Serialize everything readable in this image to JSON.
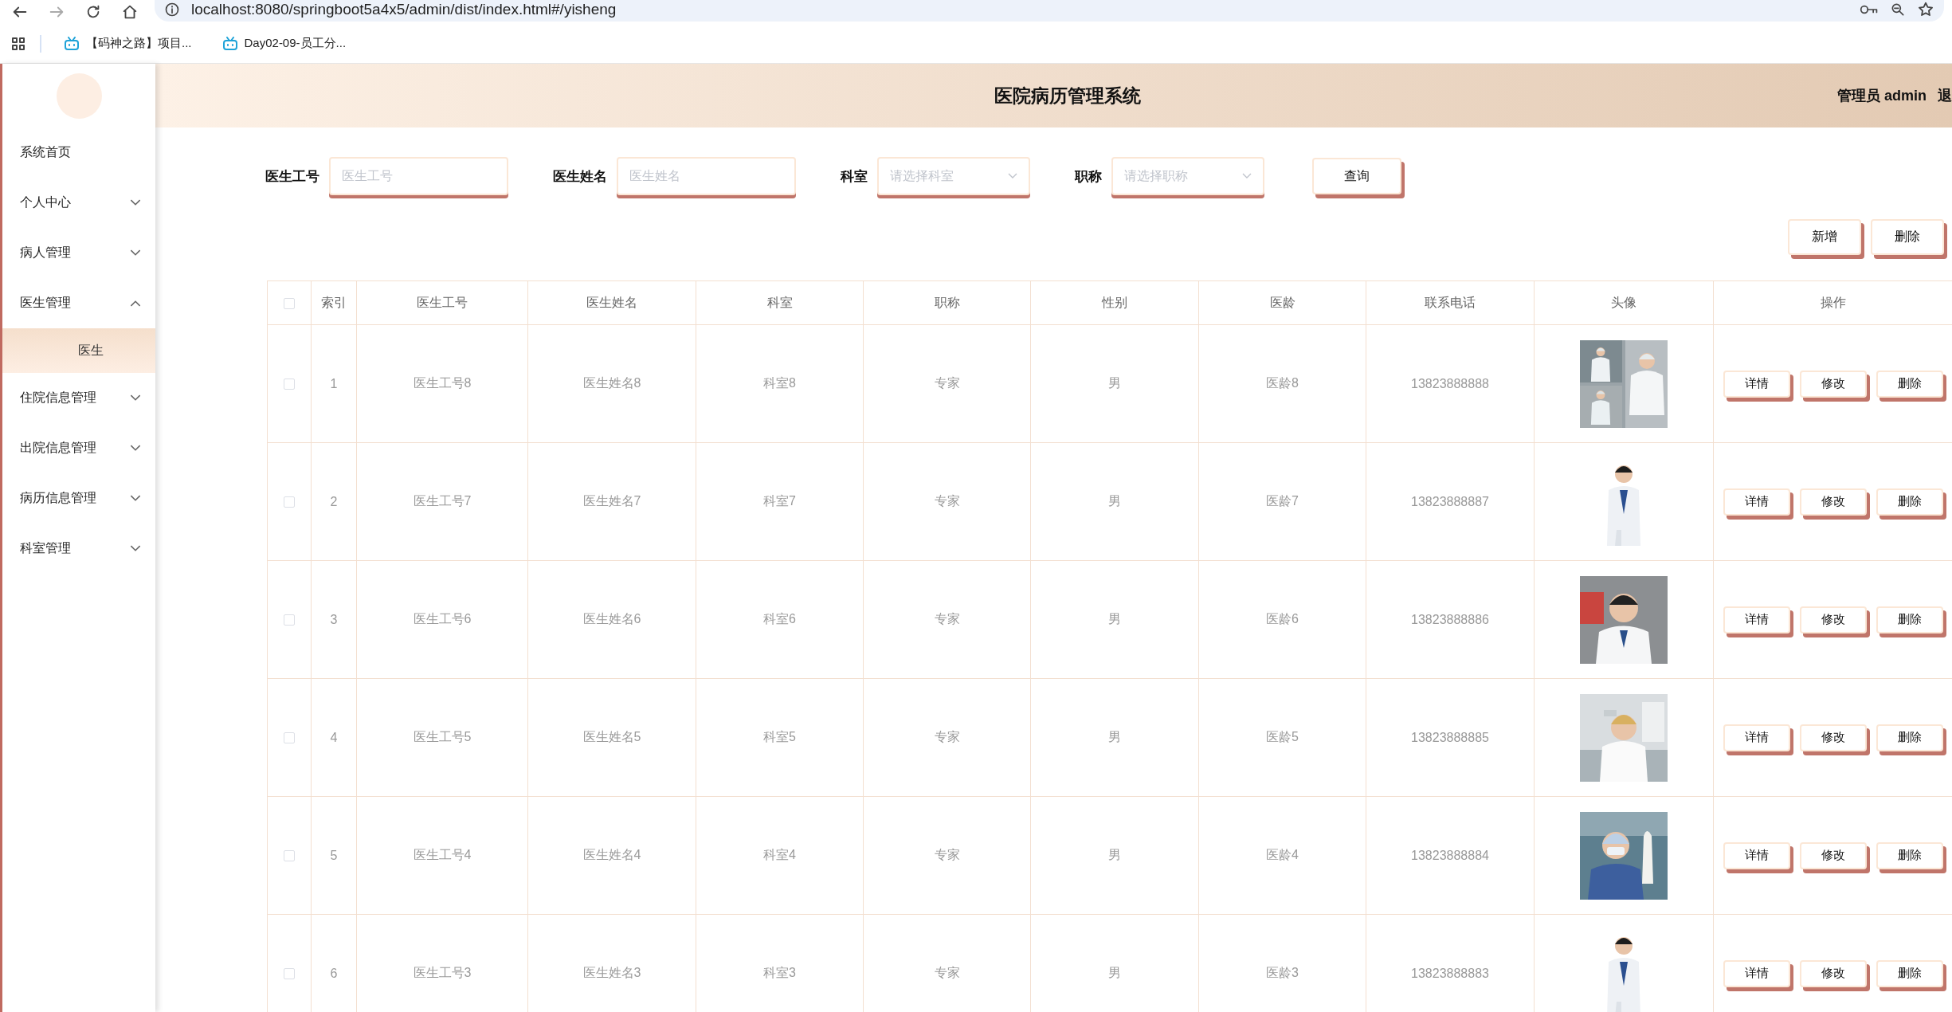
{
  "browser": {
    "url": "localhost:8080/springboot5a4x5/admin/dist/index.html#/yisheng",
    "bookmarks": [
      {
        "label": "【码神之路】项目..."
      },
      {
        "label": "Day02-09-员工分..."
      }
    ]
  },
  "sidebar": {
    "items": [
      {
        "label": "系统首页",
        "kind": "link"
      },
      {
        "label": "个人中心",
        "kind": "menu",
        "expanded": false
      },
      {
        "label": "病人管理",
        "kind": "menu",
        "expanded": false
      },
      {
        "label": "医生管理",
        "kind": "menu",
        "expanded": true,
        "children": [
          {
            "label": "医生",
            "selected": true
          }
        ]
      },
      {
        "label": "住院信息管理",
        "kind": "menu",
        "expanded": false
      },
      {
        "label": "出院信息管理",
        "kind": "menu",
        "expanded": false
      },
      {
        "label": "病历信息管理",
        "kind": "menu",
        "expanded": false
      },
      {
        "label": "科室管理",
        "kind": "menu",
        "expanded": false
      }
    ]
  },
  "header": {
    "title": "医院病历管理系统",
    "user": "管理员 admin",
    "logout": "退"
  },
  "search": {
    "fields": [
      {
        "label": "医生工号",
        "placeholder": "医生工号",
        "kind": "input"
      },
      {
        "label": "医生姓名",
        "placeholder": "医生姓名",
        "kind": "input"
      },
      {
        "label": "科室",
        "placeholder": "请选择科室",
        "kind": "select"
      },
      {
        "label": "职称",
        "placeholder": "请选择职称",
        "kind": "select"
      }
    ],
    "button": "查询"
  },
  "actions": [
    "新增",
    "删除"
  ],
  "table": {
    "header_checked": false,
    "columns": [
      "索引",
      "医生工号",
      "医生姓名",
      "科室",
      "职称",
      "性别",
      "医龄",
      "联系电话",
      "头像",
      "操作"
    ],
    "rows": [
      {
        "checked": false,
        "index": "1",
        "id": "医生工号8",
        "name": "医生姓名8",
        "dept": "科室8",
        "title": "专家",
        "gender": "男",
        "years": "医龄8",
        "phone": "13823888888",
        "avatar": {
          "kind": "picture"
        },
        "buttons": [
          "详情",
          "修改",
          "删除"
        ]
      },
      {
        "checked": false,
        "index": "2",
        "id": "医生工号7",
        "name": "医生姓名7",
        "dept": "科室7",
        "title": "专家",
        "gender": "男",
        "years": "医龄7",
        "phone": "13823888887",
        "avatar": {
          "kind": "picture"
        },
        "buttons": [
          "详情",
          "修改",
          "删除"
        ]
      },
      {
        "checked": false,
        "index": "3",
        "id": "医生工号6",
        "name": "医生姓名6",
        "dept": "科室6",
        "title": "专家",
        "gender": "男",
        "years": "医龄6",
        "phone": "13823888886",
        "avatar": {
          "kind": "picture"
        },
        "buttons": [
          "详情",
          "修改",
          "删除"
        ]
      },
      {
        "checked": false,
        "index": "4",
        "id": "医生工号5",
        "name": "医生姓名5",
        "dept": "科室5",
        "title": "专家",
        "gender": "男",
        "years": "医龄5",
        "phone": "13823888885",
        "avatar": {
          "kind": "picture"
        },
        "buttons": [
          "详情",
          "修改",
          "删除"
        ]
      },
      {
        "checked": false,
        "index": "5",
        "id": "医生工号4",
        "name": "医生姓名4",
        "dept": "科室4",
        "title": "专家",
        "gender": "男",
        "years": "医龄4",
        "phone": "13823888884",
        "avatar": {
          "kind": "picture"
        },
        "buttons": [
          "详情",
          "修改",
          "删除"
        ]
      },
      {
        "checked": false,
        "index": "6",
        "id": "医生工号3",
        "name": "医生姓名3",
        "dept": "科室3",
        "title": "专家",
        "gender": "男",
        "years": "医龄3",
        "phone": "13823888883",
        "avatar": {
          "kind": "picture"
        },
        "buttons": [
          "详情",
          "修改",
          "删除"
        ]
      }
    ]
  }
}
